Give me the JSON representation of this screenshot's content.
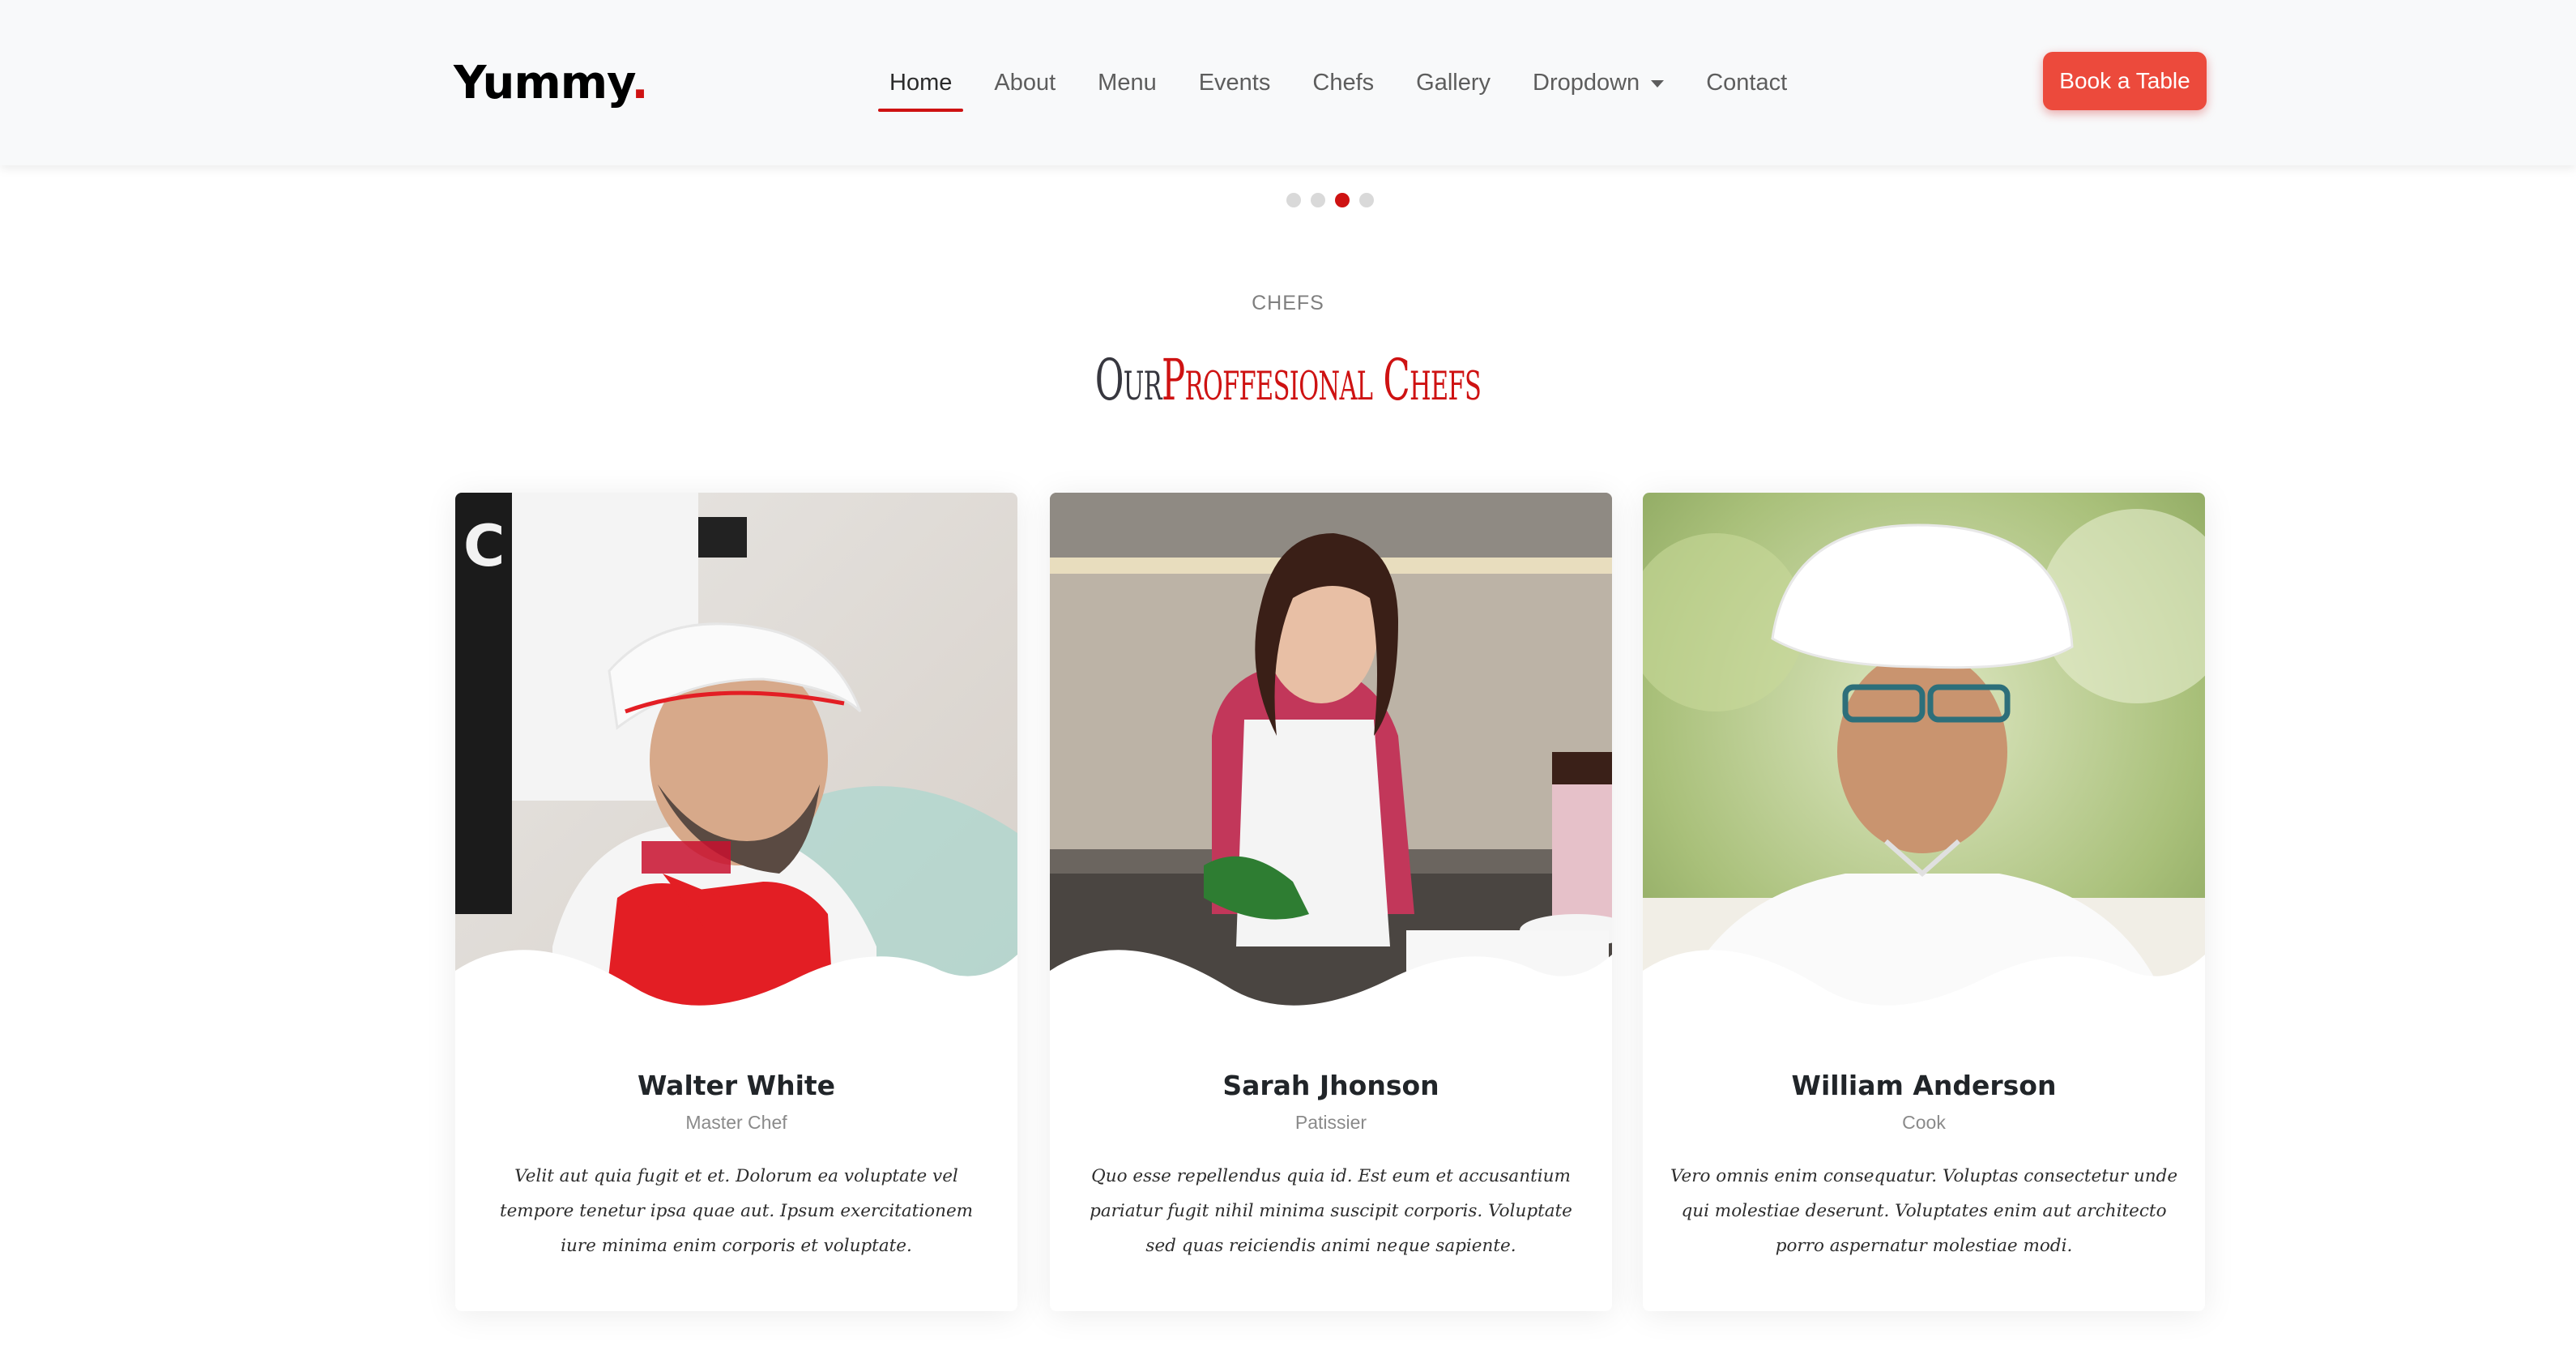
{
  "header": {
    "logo_text": "Yummy",
    "logo_dot": ".",
    "nav": [
      {
        "label": "Home",
        "active": true
      },
      {
        "label": "About"
      },
      {
        "label": "Menu"
      },
      {
        "label": "Events"
      },
      {
        "label": "Chefs"
      },
      {
        "label": "Gallery"
      },
      {
        "label": "Dropdown",
        "has_caret": true
      },
      {
        "label": "Contact"
      }
    ],
    "cta_label": "Book a Table"
  },
  "carousel": {
    "dot_count": 4,
    "active_index": 2
  },
  "section": {
    "eyebrow": "CHEFS",
    "title_plain": "Our",
    "title_accent": "Proffesional Chefs"
  },
  "chefs": [
    {
      "name": "Walter White",
      "role": "Master Chef",
      "bio": "Velit aut quia fugit et et. Dolorum ea voluptate vel tempore tenetur ipsa quae aut. Ipsum exercitationem iure minima enim corporis et voluptate.",
      "photo_icon": "chef-photo-walter"
    },
    {
      "name": "Sarah Jhonson",
      "role": "Patissier",
      "bio": "Quo esse repellendus quia id. Est eum et accusantium pariatur fugit nihil minima suscipit corporis. Voluptate sed quas reiciendis animi neque sapiente.",
      "photo_icon": "chef-photo-sarah"
    },
    {
      "name": "William Anderson",
      "role": "Cook",
      "bio": "Vero omnis enim consequatur. Voluptas consectetur unde qui molestiae deserunt. Voluptates enim aut architecto porro aspernatur molestiae modi.",
      "photo_icon": "chef-photo-william"
    }
  ],
  "colors": {
    "accent": "#ce1212",
    "button": "#ec4a3c",
    "header_bg": "#f8f9fa"
  }
}
